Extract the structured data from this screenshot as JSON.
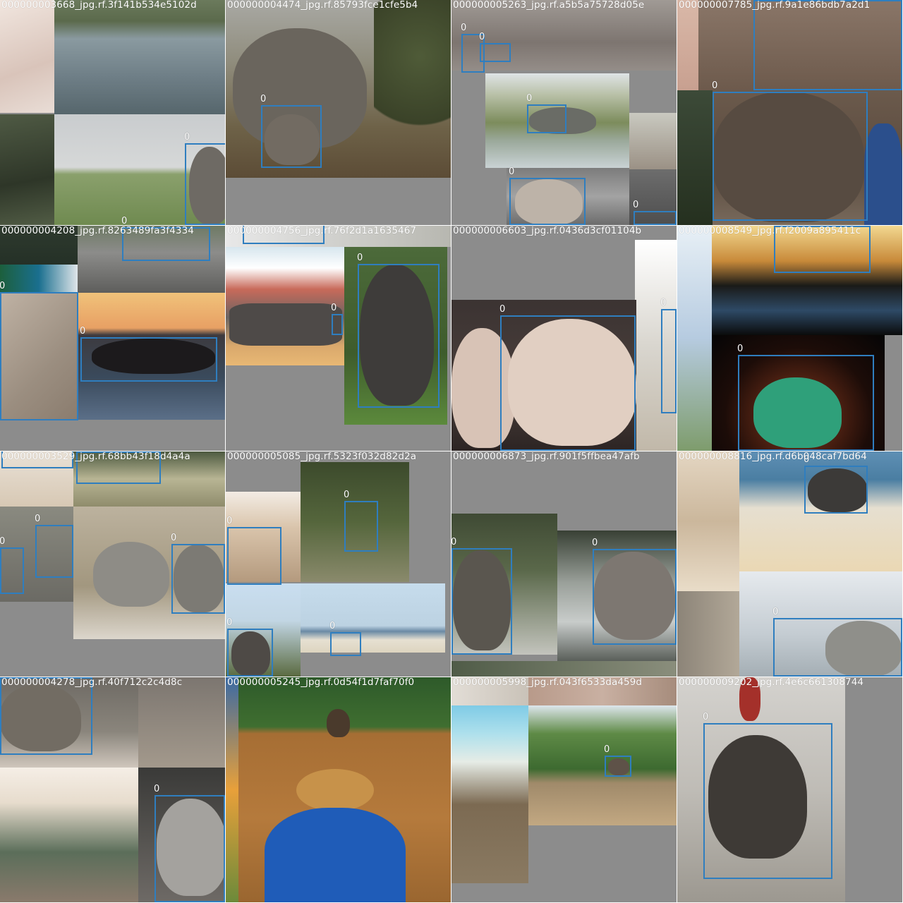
{
  "mosaic": {
    "tiles": [
      {
        "title": "000000003668_jpg.rf.3f141b534e5102d",
        "box_labels": [
          "0",
          "0"
        ]
      },
      {
        "title": "000000004474_jpg.rf.85793fce1cfe5b4",
        "box_labels": [
          "0"
        ]
      },
      {
        "title": "000000005263_jpg.rf.a5b5a75728d05e",
        "box_labels": [
          "0",
          "0",
          "0",
          "0",
          "0"
        ]
      },
      {
        "title": "000000007785_jpg.rf.9a1e86bdb7a2d1",
        "box_labels": [
          "0",
          "0"
        ]
      },
      {
        "title": "000000004208_jpg.rf.8263489fa3f4334",
        "box_labels": [
          "0",
          "0",
          "0"
        ]
      },
      {
        "title": "000000004756_jpg.rf.76f2d1a1635467",
        "box_labels": [
          "0",
          "0",
          "0"
        ]
      },
      {
        "title": "000000006603_jpg.rf.0436d3cf01104b",
        "box_labels": [
          "0",
          "0"
        ]
      },
      {
        "title": "000000008549_jpg.rf.f2009a895411c",
        "box_labels": [
          "0",
          "0"
        ]
      },
      {
        "title": "000000003529_jpg.rf.68bb43f18d4a4a",
        "box_labels": [
          "0",
          "0",
          "0",
          "0",
          "0"
        ]
      },
      {
        "title": "000000005085_jpg.rf.5323f032d82d2a",
        "box_labels": [
          "0",
          "0",
          "0",
          "0"
        ]
      },
      {
        "title": "000000006873_jpg.rf.901f5ffbea47afb",
        "box_labels": [
          "0",
          "0"
        ]
      },
      {
        "title": "000000008816_jpg.rf.d6b048caf7bd64",
        "box_labels": [
          "0",
          "0"
        ]
      },
      {
        "title": "000000004278_jpg.rf.40f712c2c4d8c",
        "box_labels": [
          "0",
          "0"
        ]
      },
      {
        "title": "000000005245_jpg.rf.0d54f1d7faf70f0",
        "box_labels": []
      },
      {
        "title": "000000005998_jpg.rf.043f6533da459d",
        "box_labels": [
          "0"
        ]
      },
      {
        "title": "000000009202_jpg.rf.4e6c661308744",
        "box_labels": [
          "0"
        ]
      }
    ]
  },
  "colors": {
    "box": "#2f7ebf",
    "label": "#ffffff",
    "fill": "#8c8c8c"
  }
}
